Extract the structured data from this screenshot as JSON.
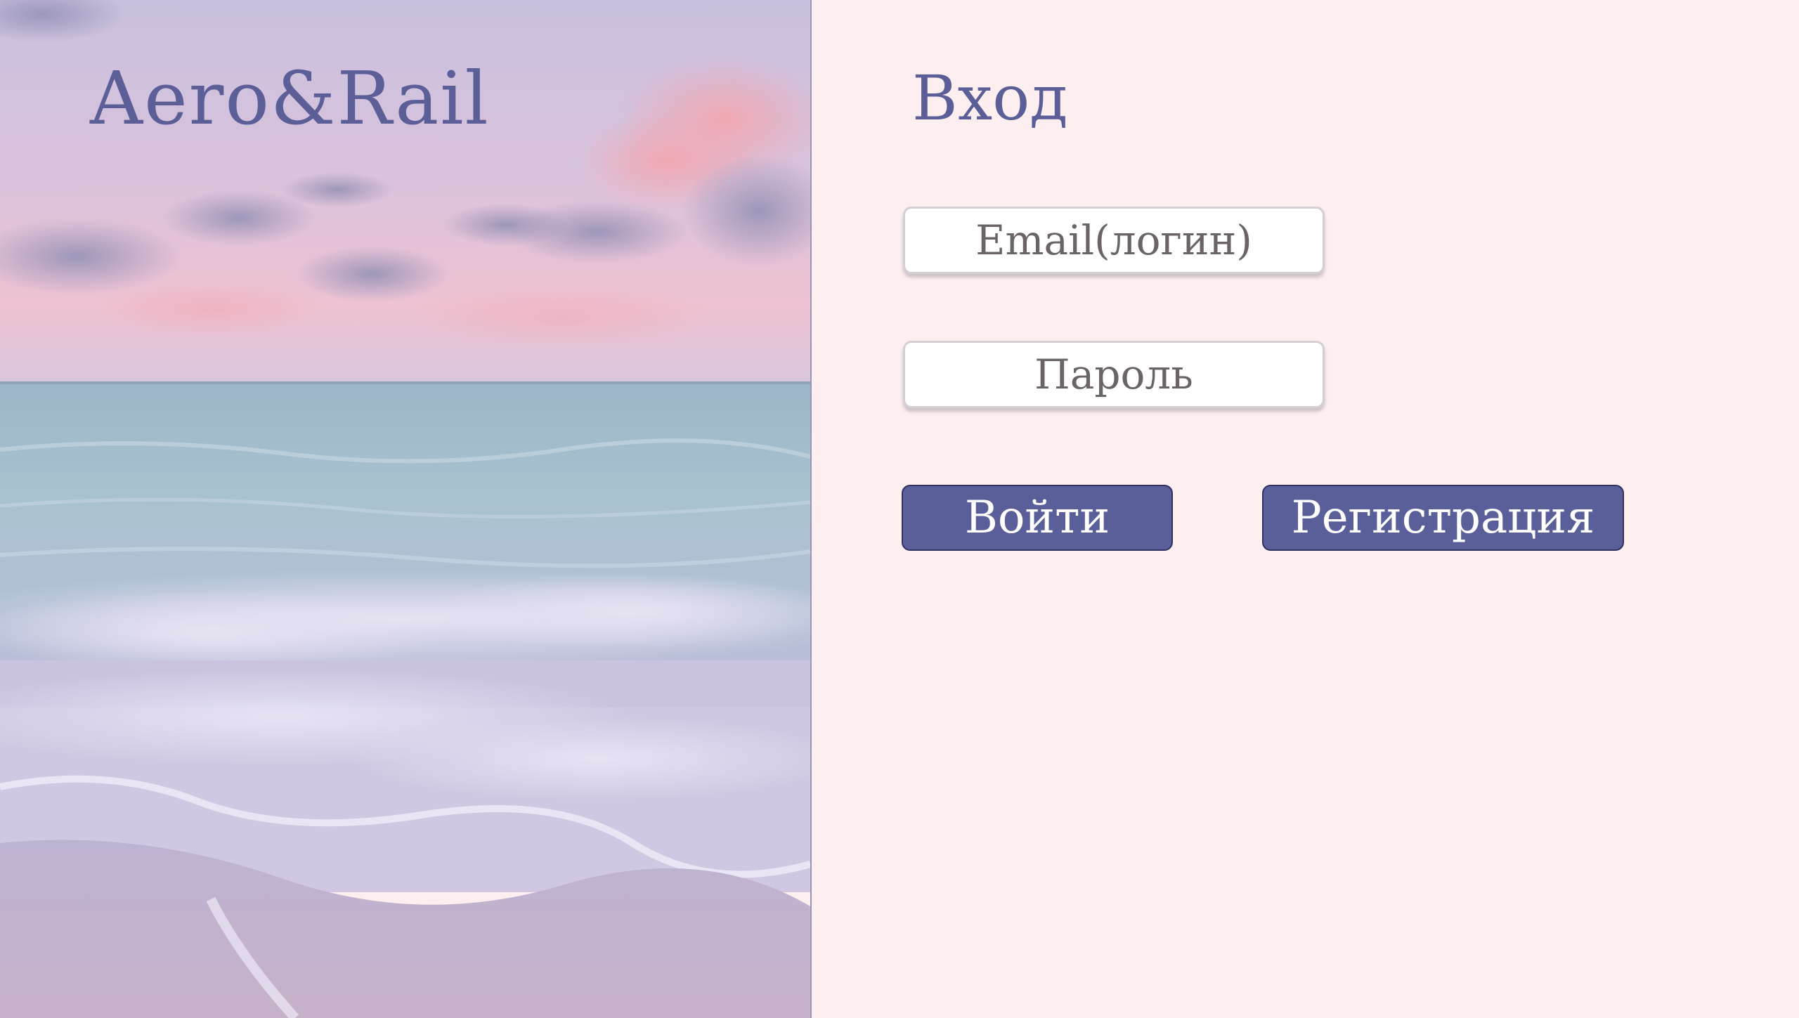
{
  "brand": {
    "title": "Aero&Rail"
  },
  "hero": {
    "image": "pastel-sea-beach-photo"
  },
  "login": {
    "title": "Вход",
    "email_placeholder": "Email(логин)",
    "password_placeholder": "Пароль",
    "login_button": "Войти",
    "register_button": "Регистрация"
  },
  "colors": {
    "accent": "#5b5f99",
    "brand_text": "#5c5f97",
    "panel_background": "#fdeeef",
    "placeholder_text": "#6a6468"
  }
}
